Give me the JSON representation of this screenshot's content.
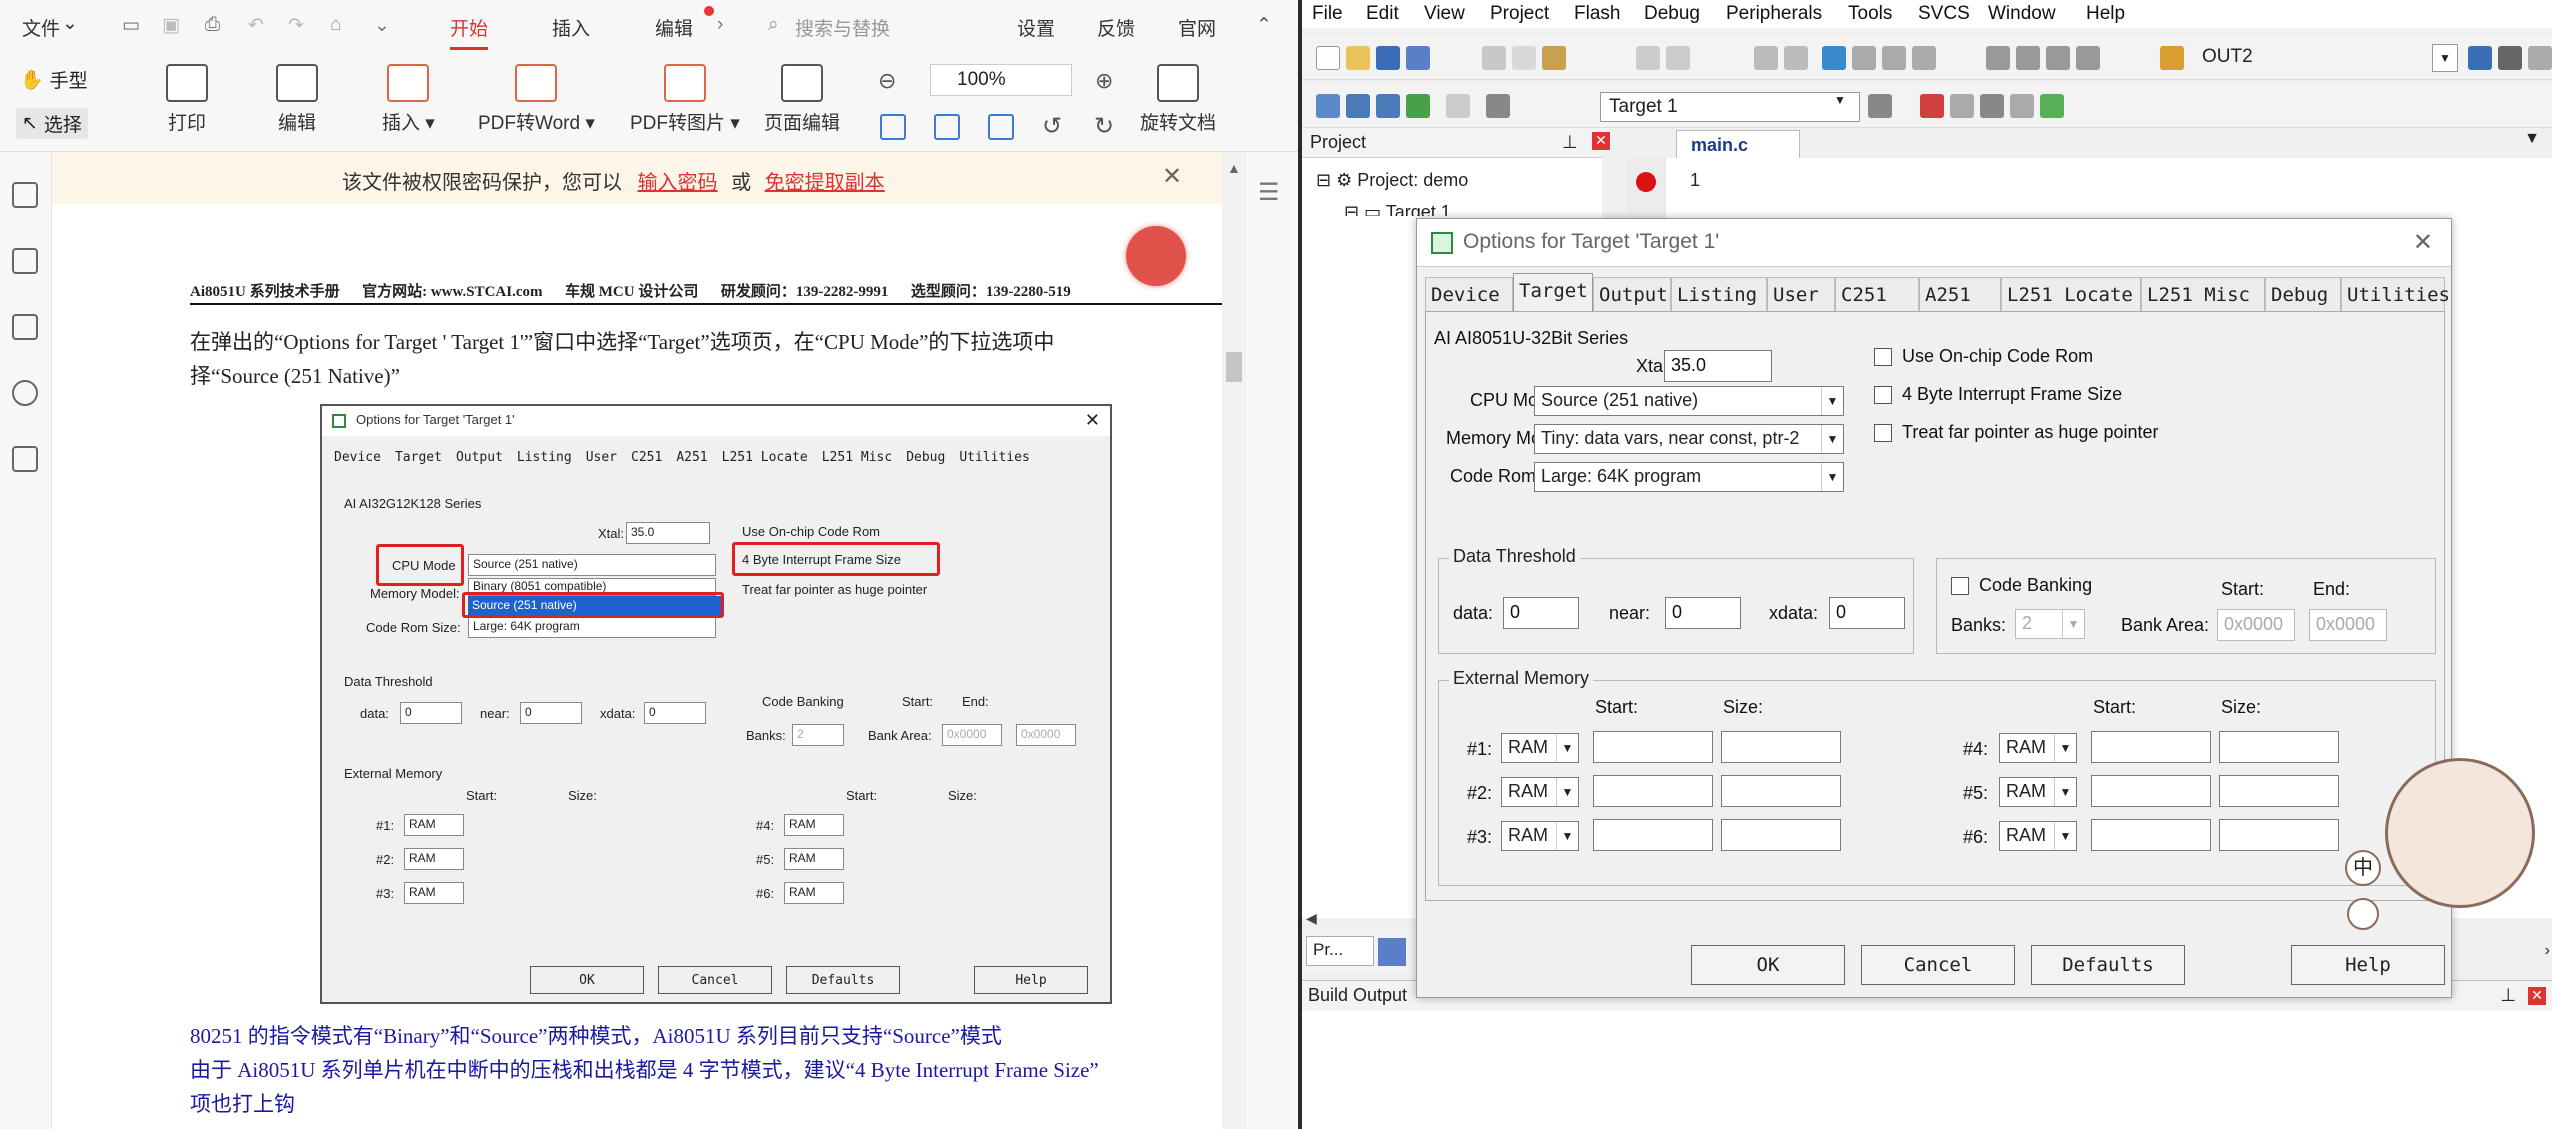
{
  "wps": {
    "top_menu": [
      "文件",
      "开始",
      "插入",
      "编辑",
      "搜索与替换",
      "设置",
      "反馈",
      "官网"
    ],
    "tools": {
      "hand": "手型",
      "select": "选择",
      "print": "打印",
      "edit": "编辑",
      "insert": "插入",
      "pdf_word": "PDF转Word",
      "pdf_image": "PDF转图片",
      "page_edit": "页面编辑",
      "zoom": "100%",
      "rotate": "旋转文档"
    },
    "notice": {
      "text": "该文件被权限密码保护，您可以",
      "link1": "输入密码",
      "or": "或",
      "link2": "免密提取副本"
    },
    "doc": {
      "header": "Ai8051U 系列技术手册      官方网站: www.STCAI.com      车规 MCU 设计公司      研发顾问：139-2282-9991      选型顾问：139-2280-519",
      "para1": "在弹出的“Options for Target ' Target 1'”窗口中选择“Target”选项页，在“CPU Mode”的下拉选项中",
      "para1b": "择“Source (251 Native)”",
      "para2": "80251 的指令模式有“Binary”和“Source”两种模式，Ai8051U 系列目前只支持“Source”模式",
      "para3": "由于 Ai8051U 系列单片机在中断中的压栈和出栈都是 4 字节模式，建议“4 Byte Interrupt Frame Size”",
      "para3b": "项也打上钩"
    },
    "embedded": {
      "title": "Options for Target 'Target 1'",
      "tabs": [
        "Device",
        "Target",
        "Output",
        "Listing",
        "User",
        "C251",
        "A251",
        "L251 Locate",
        "L251 Misc",
        "Debug",
        "Utilities"
      ],
      "series": "AI AI32G12K128 Series",
      "xtal_label": "Xtal:",
      "xtal": "35.0",
      "cpu_mode_label": "CPU Mode",
      "cpu_mode": "Source (251 native)",
      "mem_label": "Memory Model:",
      "dropdown_opt1": "Binary (8051 compatible)",
      "dropdown_opt2": "Source (251 native)",
      "coderom_label": "Code Rom Size:",
      "coderom": "Large: 64K program",
      "chk1": "Use On-chip Code Rom",
      "chk2": "4 Byte Interrupt Frame Size",
      "chk3": "Treat far pointer as huge pointer",
      "dt": "Data Threshold",
      "data": "data:",
      "near": "near:",
      "xdata": "xdata:",
      "zero": "0",
      "cb": "Code Banking",
      "start": "Start:",
      "end": "End:",
      "banks": "Banks:",
      "banks_v": "2",
      "bankarea": "Bank Area:",
      "hex0": "0x0000",
      "ext": "External Memory",
      "size": "Size:",
      "rows_left": [
        "#1:",
        "#2:",
        "#3:"
      ],
      "rows_right": [
        "#4:",
        "#5:",
        "#6:"
      ],
      "ram": "RAM",
      "ok": "OK",
      "cancel": "Cancel",
      "defaults": "Defaults",
      "help": "Help"
    }
  },
  "uvision": {
    "menu": [
      "File",
      "Edit",
      "View",
      "Project",
      "Flash",
      "Debug",
      "Peripherals",
      "Tools",
      "SVCS",
      "Window",
      "Help"
    ],
    "toolbar_out": "OUT2",
    "target_combo": "Target 1",
    "project_panel": "Project",
    "project_root": "Project: demo",
    "target_node": "Target 1",
    "editor_tab": "main.c",
    "line_no": "1",
    "bottom_tab": "Pr...",
    "build_output": "Build Output"
  },
  "dialog": {
    "title": "Options for Target 'Target 1'",
    "tabs": [
      "Device",
      "Target",
      "Output",
      "Listing",
      "User",
      "C251",
      "A251",
      "L251 Locate",
      "L251 Misc",
      "Debug",
      "Utilities"
    ],
    "series": "AI AI8051U-32Bit Series",
    "xtal_label": "Xtal:",
    "xtal": "35.0",
    "cpu_mode_label": "CPU Mode:",
    "cpu_mode": "Source (251 native)",
    "mem_label": "Memory Model:",
    "mem": "Tiny: data vars, near const, ptr-2",
    "rom_label": "Code Rom Size:",
    "rom": "Large: 64K program",
    "chk1": "Use On-chip Code Rom",
    "chk2": "4 Byte Interrupt Frame Size",
    "chk3": "Treat far pointer as huge pointer",
    "data_threshold": "Data Threshold",
    "data_label": "data:",
    "near_label": "near:",
    "xdata_label": "xdata:",
    "zero": "0",
    "code_banking": "Code Banking",
    "start": "Start:",
    "end": "End:",
    "banks_label": "Banks:",
    "banks": "2",
    "bank_area": "Bank Area:",
    "hex0": "0x0000",
    "external_memory": "External Memory",
    "size": "Size:",
    "rows_left": [
      "#1:",
      "#2:",
      "#3:"
    ],
    "rows_right": [
      "#4:",
      "#5:",
      "#6:"
    ],
    "ram": "RAM",
    "ok": "OK",
    "cancel": "Cancel",
    "defaults": "Defaults",
    "help": "Help"
  },
  "mascot_text": "中"
}
